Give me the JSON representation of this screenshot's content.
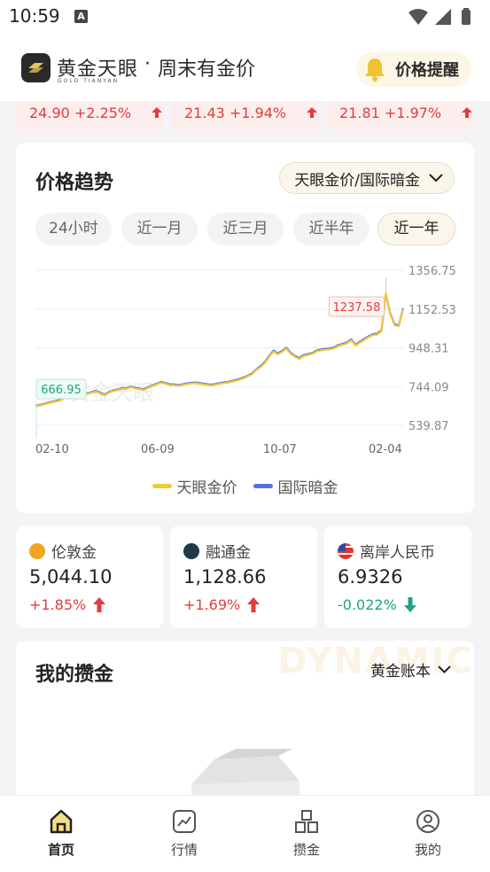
{
  "status_bar": {
    "time": "10:59",
    "notif_glyph": "A"
  },
  "header": {
    "logo_cn": "黄金天眼",
    "logo_en": "GOLD TIANYAN",
    "dot": "·",
    "subtitle": "周末有金价",
    "alert_label": "价格提醒",
    "icon": "bell-icon"
  },
  "price_strip": [
    {
      "text": "24.90 +2.25%"
    },
    {
      "text": "21.43 +1.94%"
    },
    {
      "text": "21.81 +1.97%"
    }
  ],
  "trend": {
    "title": "价格趋势",
    "source_label": "天眼金价/国际暗金",
    "ranges": [
      {
        "label": "24小时",
        "active": false
      },
      {
        "label": "近一月",
        "active": false
      },
      {
        "label": "近三月",
        "active": false
      },
      {
        "label": "近半年",
        "active": false
      },
      {
        "label": "近一年",
        "active": true
      }
    ]
  },
  "chart_data": {
    "type": "line",
    "y_ticks": [
      "1356.75",
      "1152.53",
      "948.31",
      "744.09",
      "539.87"
    ],
    "ylim": [
      539.87,
      1356.75
    ],
    "x_ticks": [
      "02-10",
      "06-09",
      "10-07",
      "02-04"
    ],
    "max_label": "1237.58",
    "min_label": "666.95",
    "watermark": "黄金天眼",
    "series": [
      {
        "name": "天眼金价",
        "color": "#f0c93a",
        "values": [
          640,
          645,
          650,
          656,
          662,
          667,
          672,
          690,
          700,
          712,
          720,
          716,
          705,
          712,
          718,
          707,
          698,
          712,
          720,
          726,
          733,
          732,
          740,
          735,
          730,
          726,
          736,
          747,
          755,
          764,
          760,
          752,
          752,
          748,
          752,
          757,
          760,
          762,
          759,
          755,
          752,
          751,
          756,
          760,
          763,
          767,
          773,
          779,
          787,
          797,
          808,
          830,
          846,
          868,
          899,
          929,
          914,
          927,
          944,
          917,
          900,
          890,
          905,
          911,
          916,
          930,
          935,
          938,
          940,
          945,
          958,
          965,
          972,
          988,
          960,
          976,
          990,
          1004,
          1015,
          1018,
          1036,
          1237,
          1125,
          1068,
          1062,
          1152
        ]
      },
      {
        "name": "国际暗金",
        "color": "#5a6ee6",
        "values": [
          642,
          648,
          653,
          660,
          665,
          670,
          676,
          694,
          705,
          716,
          725,
          719,
          708,
          716,
          722,
          711,
          702,
          716,
          724,
          730,
          737,
          736,
          744,
          739,
          734,
          730,
          740,
          751,
          759,
          768,
          764,
          756,
          756,
          752,
          756,
          761,
          764,
          766,
          763,
          759,
          756,
          755,
          760,
          764,
          767,
          771,
          777,
          783,
          791,
          801,
          812,
          834,
          851,
          873,
          904,
          934,
          919,
          932,
          949,
          922,
          905,
          895,
          910,
          916,
          921,
          935,
          940,
          943,
          945,
          950,
          963,
          970,
          977,
          993,
          965,
          981,
          995,
          1009,
          1020,
          1023,
          1041,
          1232,
          1130,
          1073,
          1067,
          1157
        ]
      }
    ]
  },
  "quotes": [
    {
      "name": "伦敦金",
      "value": "5,044.10",
      "change": "+1.85%",
      "dir": "up",
      "color": "#e23c3c",
      "icon": "gold-coin-icon"
    },
    {
      "name": "融通金",
      "value": "1,128.66",
      "change": "+1.69%",
      "dir": "up",
      "color": "#e23c3c",
      "icon": "rongtong-logo-icon"
    },
    {
      "name": "离岸人民币",
      "value": "6.9326",
      "change": "-0.022%",
      "dir": "down",
      "color": "#1fa386",
      "icon": "us-flag-icon"
    }
  ],
  "savings": {
    "title": "我的攒金",
    "ledger_label": "黄金账本",
    "watermark": "DYNAMIC",
    "empty_icon": "empty-box-icon"
  },
  "bottom_nav": [
    {
      "label": "首页",
      "icon": "home-icon",
      "active": true
    },
    {
      "label": "行情",
      "icon": "chart-icon",
      "active": false
    },
    {
      "label": "攒金",
      "icon": "blocks-icon",
      "active": false
    },
    {
      "label": "我的",
      "icon": "user-icon",
      "active": false
    }
  ]
}
